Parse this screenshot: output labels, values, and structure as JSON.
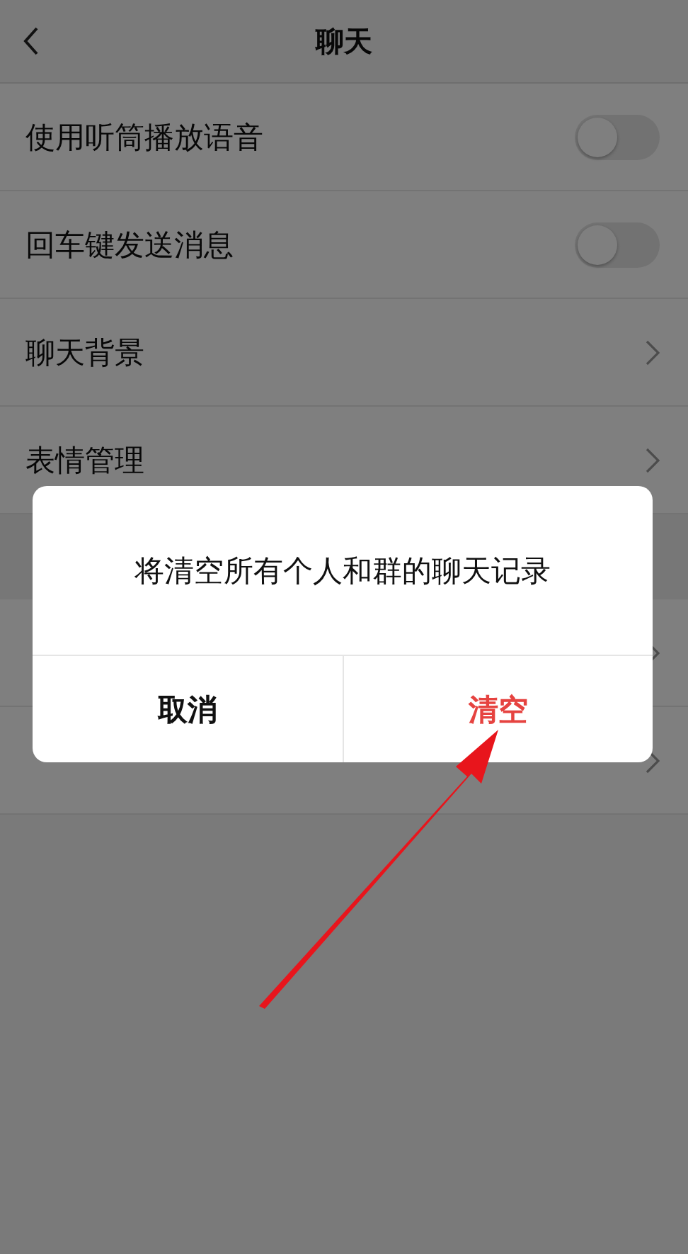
{
  "header": {
    "title": "聊天"
  },
  "rows": [
    {
      "kind": "toggle",
      "label": "使用听筒播放语音",
      "on": false
    },
    {
      "kind": "toggle",
      "label": "回车键发送消息",
      "on": false
    },
    {
      "kind": "link",
      "label": "聊天背景"
    },
    {
      "kind": "link",
      "label": "表情管理"
    },
    {
      "kind": "section"
    },
    {
      "kind": "link"
    },
    {
      "kind": "link"
    }
  ],
  "dialog": {
    "message": "将清空所有个人和群的聊天记录",
    "buttons": [
      {
        "label": "取消",
        "kind": "cancel"
      },
      {
        "label": "清空",
        "kind": "danger"
      }
    ]
  }
}
